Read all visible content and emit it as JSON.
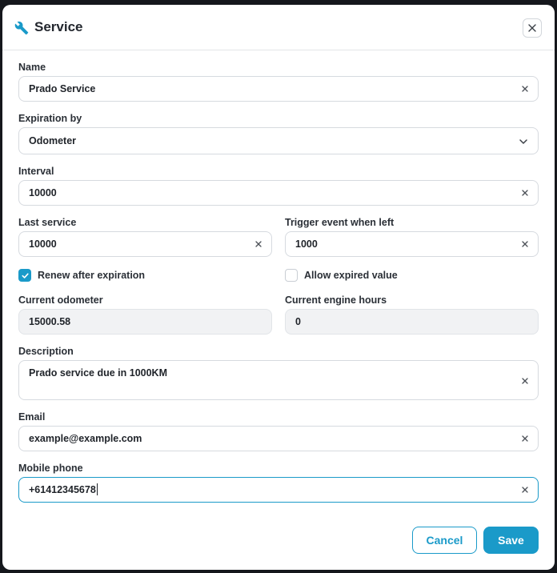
{
  "dialog": {
    "title": "Service",
    "icon": "wrench-icon",
    "accent_color": "#1a9ac9"
  },
  "form": {
    "name": {
      "label": "Name",
      "value": "Prado Service"
    },
    "expiration_by": {
      "label": "Expiration by",
      "value": "Odometer"
    },
    "interval": {
      "label": "Interval",
      "value": "10000"
    },
    "last_service": {
      "label": "Last service",
      "value": "10000"
    },
    "trigger_event": {
      "label": "Trigger event when left",
      "value": "1000"
    },
    "renew_after_expiration": {
      "label": "Renew after expiration",
      "checked": true
    },
    "allow_expired_value": {
      "label": "Allow expired value",
      "checked": false
    },
    "current_odometer": {
      "label": "Current odometer",
      "value": "15000.58"
    },
    "current_engine_hours": {
      "label": "Current engine hours",
      "value": "0"
    },
    "description": {
      "label": "Description",
      "value": "Prado service due in 1000KM"
    },
    "email": {
      "label": "Email",
      "value": "example@example.com"
    },
    "mobile_phone": {
      "label": "Mobile phone",
      "value": "+61412345678"
    }
  },
  "footer": {
    "cancel_label": "Cancel",
    "save_label": "Save"
  }
}
